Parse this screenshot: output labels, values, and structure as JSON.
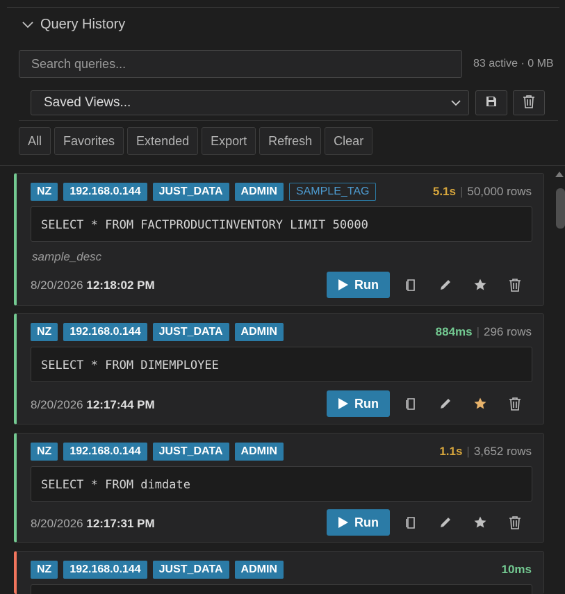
{
  "panel": {
    "title": "Query History"
  },
  "search": {
    "placeholder": "Search queries..."
  },
  "stats": "83 active · 0 MB",
  "saved_views": {
    "label": "Saved Views..."
  },
  "filters": [
    "All",
    "Favorites",
    "Extended",
    "Export",
    "Refresh",
    "Clear"
  ],
  "run_label": "Run",
  "queries": [
    {
      "tags": [
        "NZ",
        "192.168.0.144",
        "JUST_DATA",
        "ADMIN"
      ],
      "extra_tag": "SAMPLE_TAG",
      "duration": "5.1s",
      "rows": "50,000 rows",
      "sql": "SELECT * FROM FACTPRODUCTINVENTORY LIMIT 50000",
      "description": "sample_desc",
      "date": "8/20/2026",
      "time": "12:18:02 PM",
      "favorite": false
    },
    {
      "tags": [
        "NZ",
        "192.168.0.144",
        "JUST_DATA",
        "ADMIN"
      ],
      "duration": "884ms",
      "rows": "296 rows",
      "sql": "SELECT * FROM DIMEMPLOYEE",
      "date": "8/20/2026",
      "time": "12:17:44 PM",
      "favorite": true
    },
    {
      "tags": [
        "NZ",
        "192.168.0.144",
        "JUST_DATA",
        "ADMIN"
      ],
      "duration": "1.1s",
      "rows": "3,652 rows",
      "sql": "SELECT * FROM dimdate",
      "date": "8/20/2026",
      "time": "12:17:31 PM",
      "favorite": false
    },
    {
      "tags": [
        "NZ",
        "192.168.0.144",
        "JUST_DATA",
        "ADMIN"
      ],
      "duration": "10ms"
    }
  ],
  "colors": {
    "accent": "#2b7ba6",
    "success_border": "#73c991",
    "error_border": "#f1755d",
    "slow_duration": "#d7a63c",
    "fast_duration": "#73c991",
    "favorite_active": "#e8b36b"
  }
}
